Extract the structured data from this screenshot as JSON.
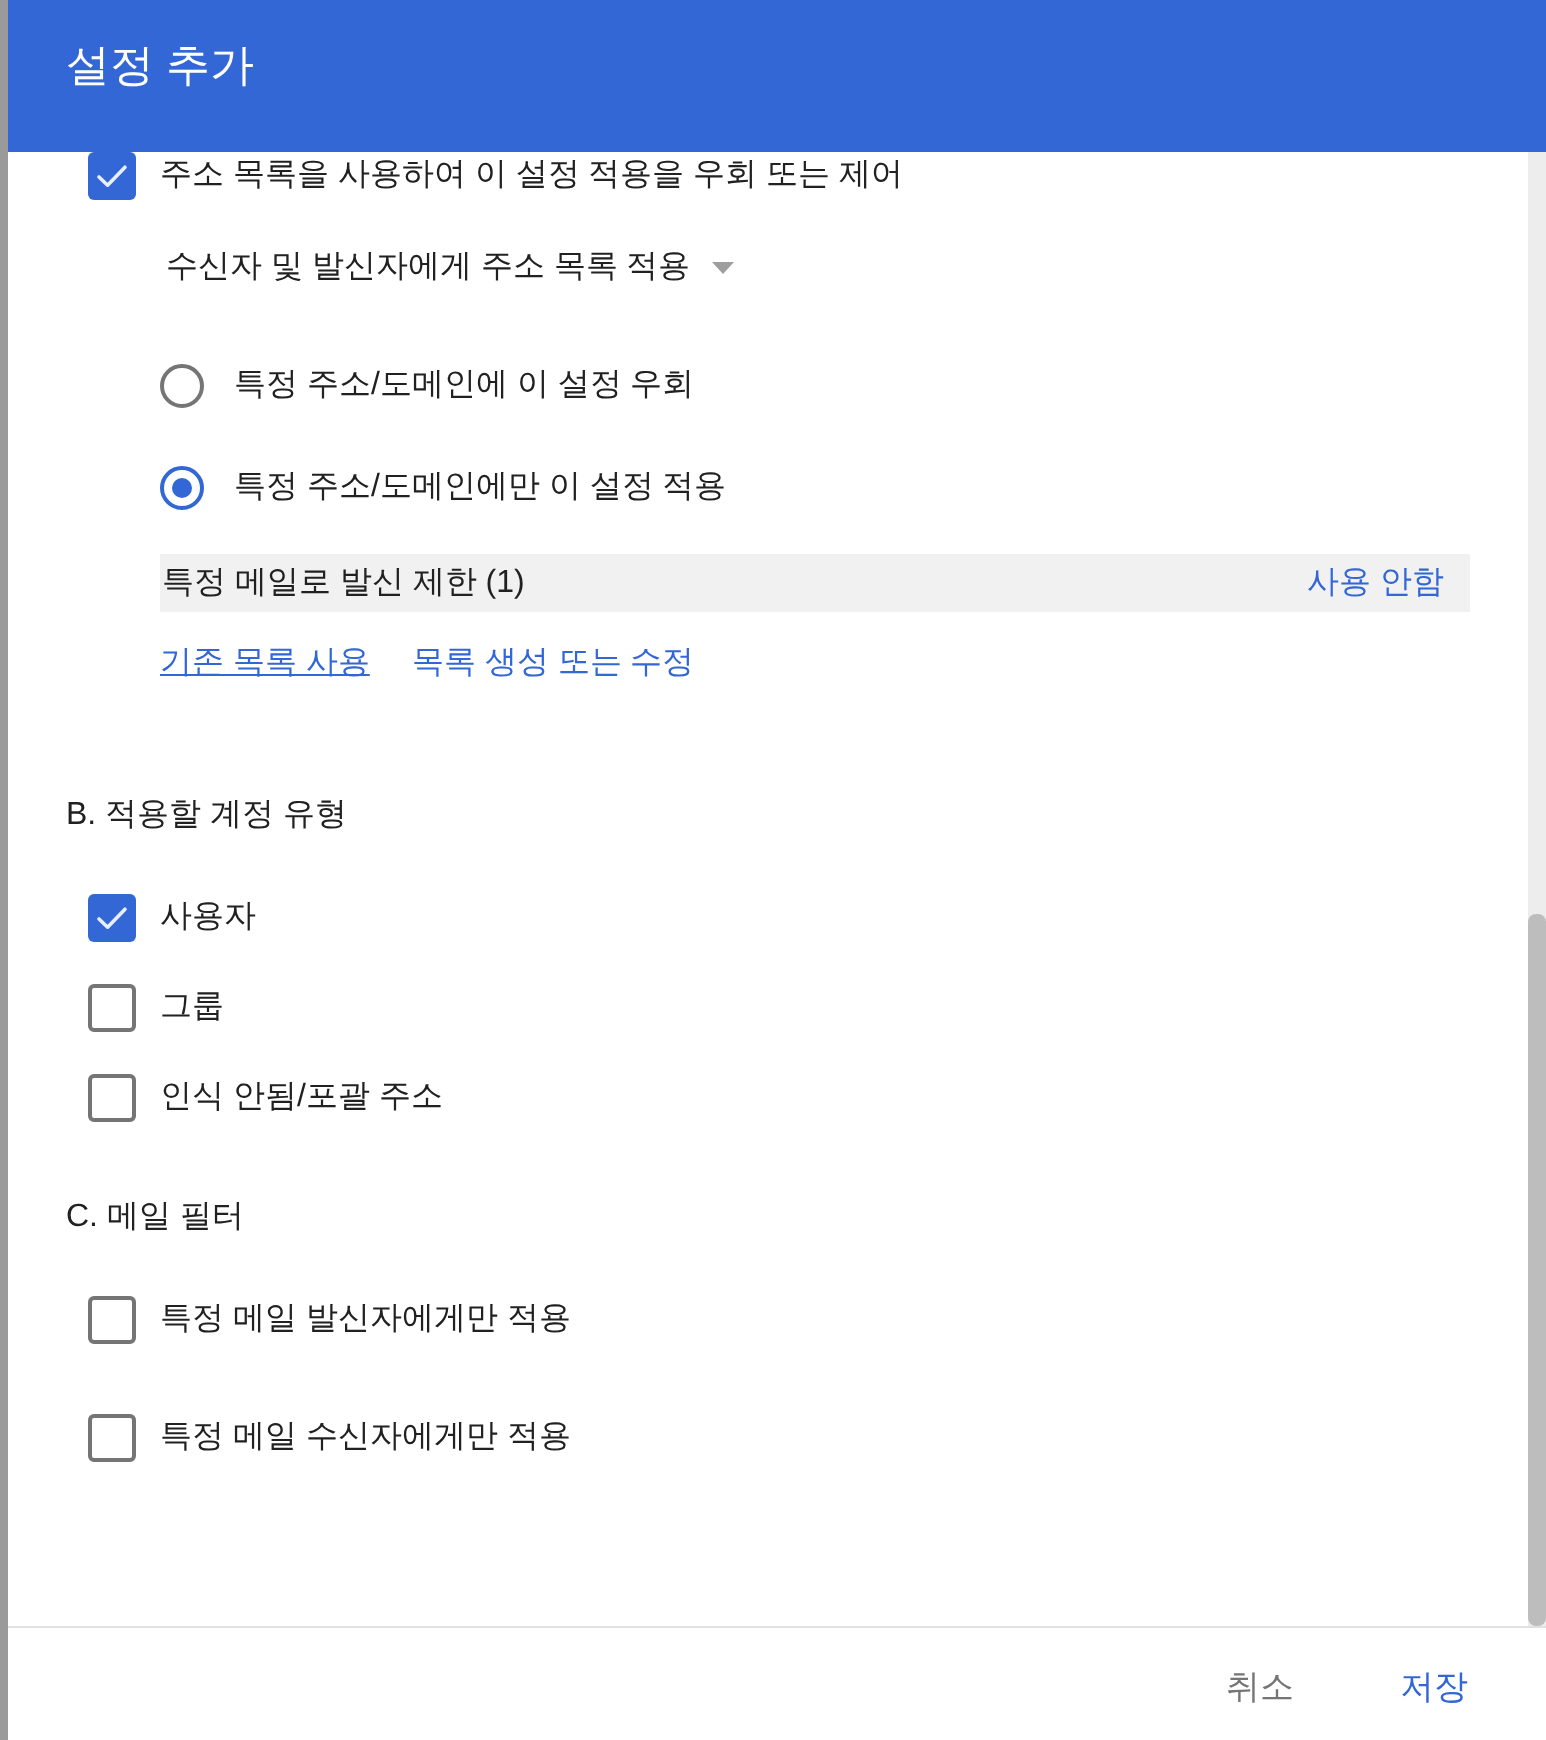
{
  "dialog": {
    "title": "설정 추가"
  },
  "address_list": {
    "option": {
      "label": "주소 목록을 사용하여 이 설정 적용을 우회 또는 제어",
      "checked": true
    },
    "dropdown": {
      "value": "수신자 및 발신자에게 주소 목록 적용"
    },
    "radios": [
      {
        "label": "특정 주소/도메인에 이 설정 우회",
        "selected": false
      },
      {
        "label": "특정 주소/도메인에만 이 설정 적용",
        "selected": true
      }
    ],
    "list_row": {
      "name": "특정 메일로 발신 제한 (1)",
      "action": "사용 안함"
    },
    "links": [
      {
        "label": "기존 목록 사용",
        "underlined": true
      },
      {
        "label": "목록 생성 또는 수정",
        "underlined": false
      }
    ]
  },
  "sections": [
    {
      "heading": "B. 적용할 계정 유형",
      "options": [
        {
          "label": "사용자",
          "checked": true
        },
        {
          "label": "그룹",
          "checked": false
        },
        {
          "label": "인식 안됨/포괄 주소",
          "checked": false
        }
      ]
    },
    {
      "heading": "C. 메일 필터",
      "options": [
        {
          "label": "특정 메일 발신자에게만 적용",
          "checked": false
        },
        {
          "label": "특정 메일 수신자에게만 적용",
          "checked": false
        }
      ]
    }
  ],
  "footer": {
    "buttons": [
      {
        "label": "취소",
        "kind": "cancel"
      },
      {
        "label": "저장",
        "kind": "save"
      }
    ]
  }
}
